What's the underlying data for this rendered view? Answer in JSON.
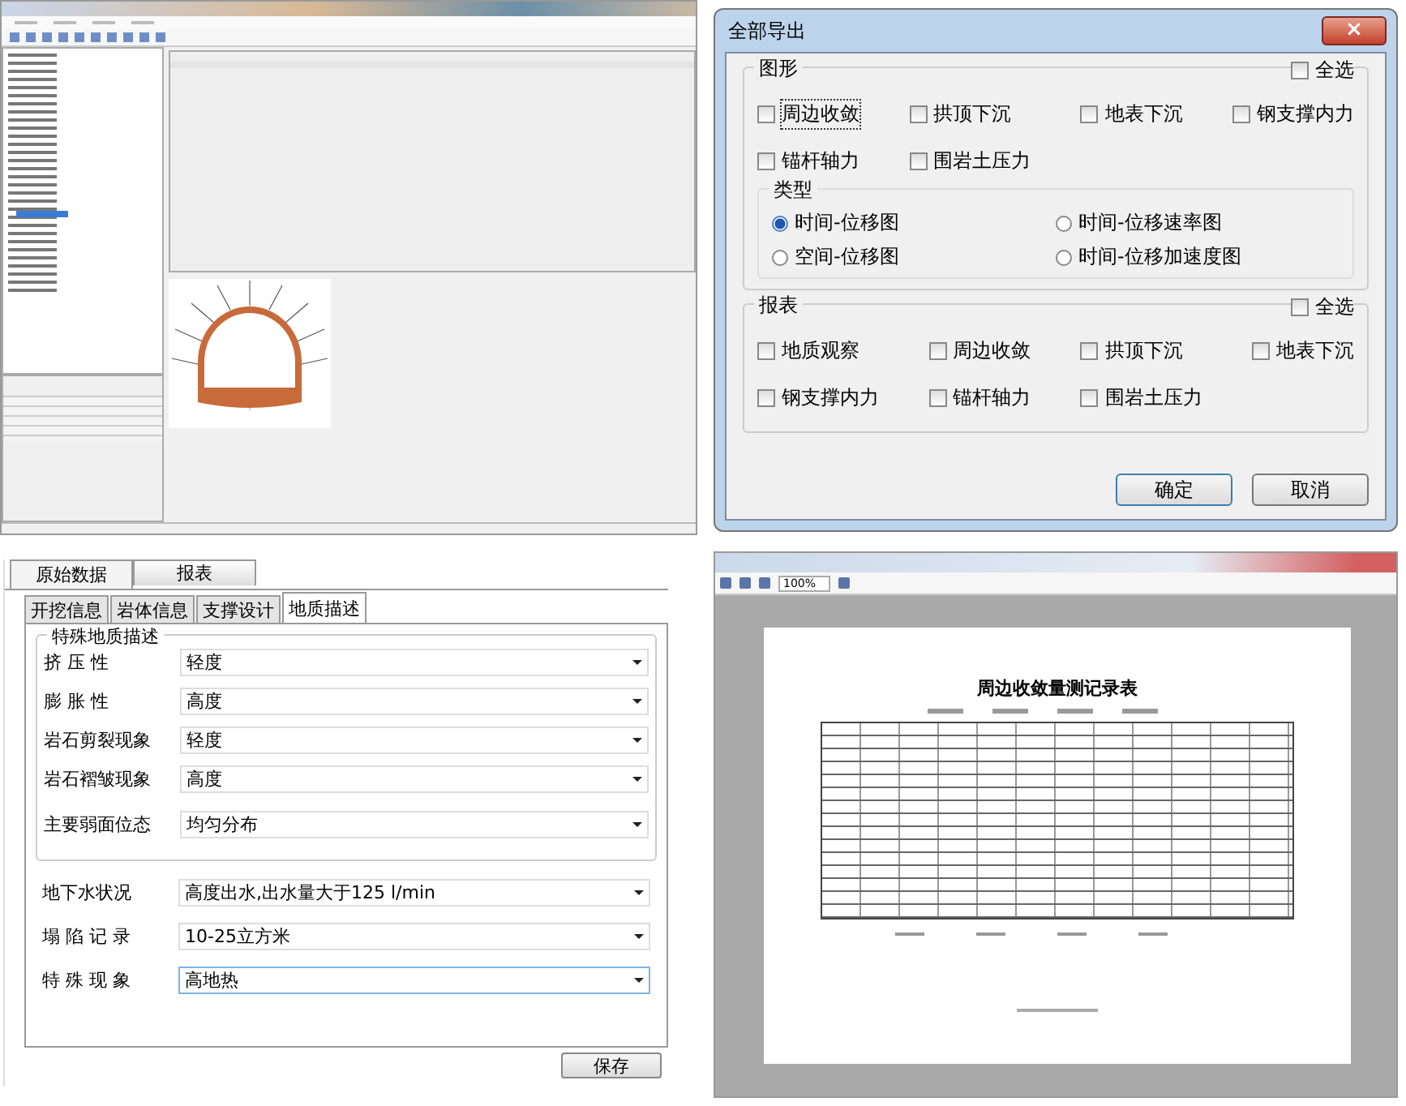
{
  "export_dialog": {
    "title": "全部导出",
    "close": "×",
    "graphics_group": {
      "title": "图形",
      "select_all": {
        "label": "全选",
        "checked": false
      },
      "items": [
        {
          "label": "周边收敛",
          "checked": false,
          "focused": true
        },
        {
          "label": "拱顶下沉",
          "checked": false,
          "focused": false
        },
        {
          "label": "地表下沉",
          "checked": false,
          "focused": false
        },
        {
          "label": "钢支撑内力",
          "checked": false,
          "focused": false
        },
        {
          "label": "锚杆轴力",
          "checked": false,
          "focused": false
        },
        {
          "label": "围岩土压力",
          "checked": false,
          "focused": false
        }
      ]
    },
    "type_group": {
      "title": "类型",
      "options": [
        {
          "label": "时间-位移图",
          "selected": true
        },
        {
          "label": "时间-位移速率图",
          "selected": false
        },
        {
          "label": "空间-位移图",
          "selected": false
        },
        {
          "label": "时间-位移加速度图",
          "selected": false
        }
      ]
    },
    "report_group": {
      "title": "报表",
      "select_all": {
        "label": "全选",
        "checked": false
      },
      "items": [
        {
          "label": "地质观察",
          "checked": false,
          "focused": false
        },
        {
          "label": "周边收敛",
          "checked": false,
          "focused": false
        },
        {
          "label": "拱顶下沉",
          "checked": false,
          "focused": false
        },
        {
          "label": "地表下沉",
          "checked": false,
          "focused": false
        },
        {
          "label": "钢支撑内力",
          "checked": false,
          "focused": false
        },
        {
          "label": "锚杆轴力",
          "checked": false,
          "focused": false
        },
        {
          "label": "围岩土压力",
          "checked": false,
          "focused": false
        }
      ]
    },
    "buttons": [
      "确定",
      "取消"
    ]
  },
  "geology_form": {
    "tabs": [
      {
        "label": "原始数据",
        "selected": true
      },
      {
        "label": "报表",
        "selected": false
      }
    ],
    "subtabs": [
      {
        "label": "开挖信息",
        "selected": false
      },
      {
        "label": "岩体信息",
        "selected": false
      },
      {
        "label": "支撑设计",
        "selected": false
      },
      {
        "label": "地质描述",
        "selected": true
      }
    ],
    "group_title": "特殊地质描述",
    "group_fields": [
      {
        "label": "挤 压 性",
        "value": "轻度",
        "focused": false
      },
      {
        "label": "膨 胀 性",
        "value": "高度",
        "focused": false
      },
      {
        "label": "岩石剪裂现象",
        "value": "轻度",
        "focused": false
      },
      {
        "label": "岩石褶皱现象",
        "value": "高度",
        "focused": false
      },
      {
        "label": "主要弱面位态",
        "value": "均匀分布",
        "focused": false
      }
    ],
    "fields": [
      {
        "label": "地下水状况",
        "value": "高度出水,出水量大于125 l/min",
        "focused": false
      },
      {
        "label": "塌 陷 记 录",
        "value": "10-25立方米",
        "focused": false
      },
      {
        "label": "特 殊 现 象",
        "value": "高地热",
        "focused": true
      }
    ],
    "save_button": "保存"
  },
  "report_preview": {
    "zoom": "100%",
    "title": "周边收敛量测记录表"
  }
}
